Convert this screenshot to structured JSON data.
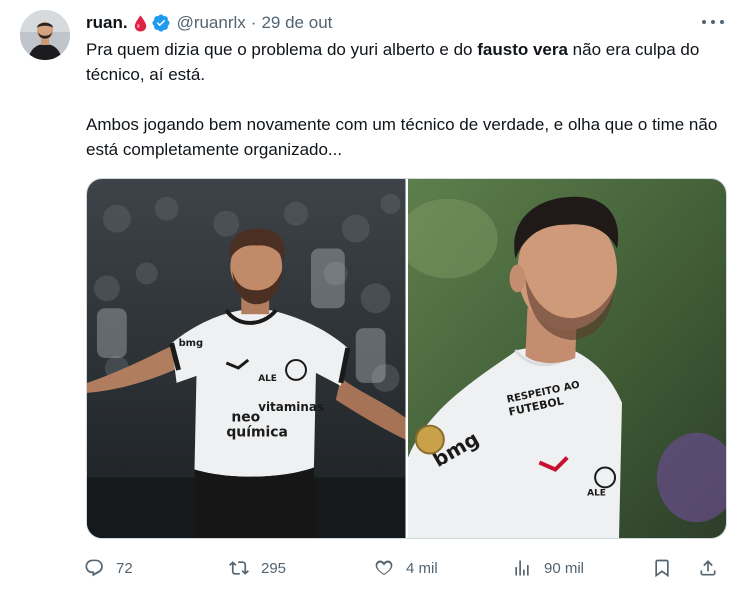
{
  "author": {
    "name": "ruan.",
    "handle": "@ruanrlx",
    "separator": "·",
    "date": "29 de out"
  },
  "text": {
    "line1_before": "Pra quem dizia que o problema do yuri alberto e do ",
    "line1_bold": "fausto vera",
    "line1_after": " não era culpa do técnico, aí está.",
    "line2": "Ambos jogando bem novamente com um técnico de verdade, e olha que o time não está completamente organizado..."
  },
  "media": {
    "left_photo": {
      "shirt_sponsor_1": "vitaminas",
      "shirt_sponsor_2": "neo",
      "shirt_sponsor_3": "química",
      "sleeve_logo": "bmg",
      "chest_logo": "ALE"
    },
    "right_photo": {
      "shirt_sponsor_1": "RESPEITO AO",
      "shirt_sponsor_2": "FUTEBOL",
      "sleeve_logo": "bmg",
      "chest_logo": "ALE"
    }
  },
  "actions": {
    "reply_count": "72",
    "retweet_count": "295",
    "like_count": "4 mil",
    "views_count": "90 mil"
  },
  "colors": {
    "text": "#0f1419",
    "muted": "#536471",
    "verified": "#1d9bf0",
    "drop": "#e0245e",
    "border": "#cfd9de"
  },
  "icons": [
    "avatar",
    "blood-drop-icon",
    "verified-icon",
    "more-icon",
    "reply-icon",
    "retweet-icon",
    "like-icon",
    "views-icon",
    "bookmark-icon",
    "share-icon"
  ]
}
